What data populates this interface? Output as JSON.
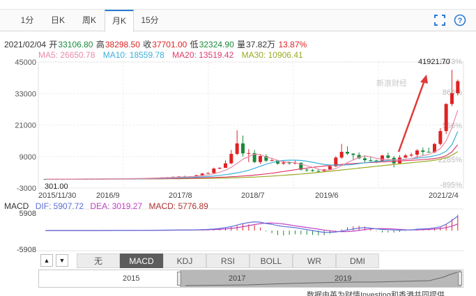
{
  "tabs": [
    {
      "label": "1分"
    },
    {
      "label": "日K"
    },
    {
      "label": "周K"
    },
    {
      "label": "月K"
    },
    {
      "label": "15分"
    }
  ],
  "active_tab": "月K",
  "info": {
    "date": "2021/02/04",
    "open_label": "开",
    "open": "33106.80",
    "high_label": "高",
    "high": "38298.50",
    "close_label": "收",
    "close": "37701.00",
    "low_label": "低",
    "low": "32324.90",
    "vol_label": "量",
    "vol": "37.82万",
    "change": "13.87%"
  },
  "ma": {
    "ma5": "MA5: 26650.78",
    "ma10": "MA10: 18559.78",
    "ma20": "MA20: 13519.42",
    "ma30": "MA30: 10906.41"
  },
  "macd": {
    "title": "MACD",
    "dif": "DIF: 5907.72",
    "dea": "DEA: 3019.27",
    "macd": "MACD: 5776.89"
  },
  "watermark": "新浪财经",
  "indicator_buttons": [
    {
      "label": "无"
    },
    {
      "label": "MACD"
    },
    {
      "label": "KDJ"
    },
    {
      "label": "RSI"
    },
    {
      "label": "BOLL"
    },
    {
      "label": "WR"
    },
    {
      "label": "DMI"
    }
  ],
  "active_indicator": "MACD",
  "nav_years": [
    "2015",
    "2017",
    "2019"
  ],
  "footnote": "数据由英为财情Investing和香港共同提供",
  "colors": {
    "up": "#e02222",
    "down": "#1a8a3a",
    "ma5": "#e88aa8",
    "ma10": "#3ab0d8",
    "ma20": "#e03a6a",
    "ma30": "#9aaa22",
    "dif": "#5b6fd8",
    "dea": "#c040c0",
    "accent": "#2b7bd6"
  },
  "chart_data": {
    "type": "candlestick",
    "yticks": [
      "45000",
      "33000",
      "21000",
      "9000",
      "-3000"
    ],
    "right_ticks": [
      "1173%",
      "864%",
      "556%",
      "2285%",
      "-895%"
    ],
    "xticks": [
      "2015/11/30",
      "2016/9",
      "2017/8",
      "2018/7",
      "2019/6",
      "2021/2/4"
    ],
    "ylim": [
      -3000,
      45000
    ],
    "annotation_max": "41921.70",
    "annotation_min": "301.00",
    "macd_yticks": [
      "5908",
      "-5908"
    ],
    "candles": [
      [
        430,
        420,
        460,
        380
      ],
      [
        420,
        400,
        440,
        370
      ],
      [
        400,
        410,
        430,
        380
      ],
      [
        410,
        380,
        430,
        360
      ],
      [
        380,
        430,
        450,
        370
      ],
      [
        430,
        450,
        470,
        420
      ],
      [
        450,
        440,
        480,
        420
      ],
      [
        440,
        430,
        470,
        410
      ],
      [
        430,
        460,
        490,
        420
      ],
      [
        460,
        470,
        500,
        440
      ],
      [
        470,
        500,
        530,
        460
      ],
      [
        500,
        560,
        580,
        490
      ],
      [
        560,
        600,
        640,
        540
      ],
      [
        600,
        580,
        650,
        560
      ],
      [
        580,
        620,
        660,
        560
      ],
      [
        620,
        670,
        710,
        600
      ],
      [
        670,
        720,
        760,
        650
      ],
      [
        720,
        760,
        800,
        700
      ],
      [
        760,
        830,
        880,
        740
      ],
      [
        830,
        970,
        1000,
        800
      ],
      [
        970,
        1050,
        1100,
        950
      ],
      [
        1050,
        1130,
        1200,
        1000
      ],
      [
        1130,
        1300,
        1350,
        1100
      ],
      [
        1300,
        1420,
        1500,
        1250
      ],
      [
        1420,
        1350,
        1700,
        1300
      ],
      [
        1350,
        1480,
        1550,
        1300
      ],
      [
        1480,
        1900,
        2000,
        1450
      ],
      [
        1900,
        2500,
        2800,
        1850
      ],
      [
        2500,
        2700,
        3000,
        2400
      ],
      [
        2700,
        4400,
        4800,
        2600
      ],
      [
        4400,
        4700,
        4900,
        4200
      ],
      [
        4700,
        6400,
        7500,
        6000
      ],
      [
        6400,
        10000,
        11500,
        6100
      ],
      [
        10000,
        14000,
        19000,
        9500
      ],
      [
        14000,
        10200,
        17000,
        9000
      ],
      [
        10200,
        10300,
        11800,
        6900
      ],
      [
        10300,
        6900,
        11500,
        6500
      ],
      [
        6900,
        9200,
        10000,
        6200
      ],
      [
        9200,
        7400,
        9900,
        6900
      ],
      [
        7400,
        7600,
        8500,
        7200
      ],
      [
        7600,
        6300,
        7700,
        5900
      ],
      [
        6300,
        6700,
        7500,
        5800
      ],
      [
        6700,
        6400,
        7200,
        5900
      ],
      [
        6400,
        6600,
        7400,
        6000
      ],
      [
        6600,
        4000,
        6800,
        3600
      ],
      [
        4000,
        3800,
        4400,
        3200
      ],
      [
        3800,
        3500,
        4300,
        3200
      ],
      [
        3500,
        3400,
        4100,
        3100
      ],
      [
        3400,
        4100,
        4200,
        3300
      ],
      [
        4100,
        5300,
        5800,
        3900
      ],
      [
        5300,
        8600,
        9100,
        5000
      ],
      [
        8600,
        10800,
        13800,
        8100
      ],
      [
        10800,
        10100,
        12900,
        9600
      ],
      [
        10100,
        9600,
        10300,
        7800
      ],
      [
        9600,
        8300,
        10600,
        8000
      ],
      [
        8300,
        7600,
        9500,
        6800
      ],
      [
        7600,
        7500,
        9100,
        6600
      ],
      [
        7500,
        7200,
        7800,
        6500
      ],
      [
        7200,
        9400,
        9600,
        6900
      ],
      [
        9400,
        8500,
        10500,
        8300
      ],
      [
        8500,
        6400,
        9200,
        4800
      ],
      [
        6400,
        8600,
        9500,
        6300
      ],
      [
        8600,
        9400,
        10000,
        8500
      ],
      [
        9400,
        9700,
        10400,
        8800
      ],
      [
        9700,
        11300,
        11800,
        8200
      ],
      [
        11300,
        10800,
        12400,
        9500
      ],
      [
        10800,
        10600,
        12400,
        10500
      ],
      [
        10600,
        13800,
        14100,
        10300
      ],
      [
        13800,
        18700,
        19800,
        13200
      ],
      [
        18700,
        29000,
        29300,
        17600
      ],
      [
        29000,
        33100,
        42000,
        28200
      ],
      [
        33100,
        37700,
        38300,
        32300
      ]
    ],
    "ma5_line": [
      430,
      430,
      425,
      420,
      420,
      430,
      440,
      440,
      445,
      455,
      470,
      500,
      530,
      555,
      575,
      610,
      650,
      690,
      740,
      820,
      900,
      980,
      1060,
      1170,
      1260,
      1330,
      1470,
      1700,
      1990,
      2420,
      3040,
      3800,
      4900,
      6400,
      7950,
      9000,
      9900,
      9800,
      8800,
      8300,
      7500,
      7000,
      6800,
      6600,
      6100,
      5500,
      4900,
      4200,
      3700,
      3900,
      4400,
      5500,
      6700,
      7700,
      8700,
      9200,
      8900,
      8300,
      7900,
      7900,
      7700,
      7700,
      7900,
      8100,
      8900,
      9300,
      9800,
      10700,
      12000,
      15000,
      20000,
      26650
    ],
    "ma10_line": [
      430,
      430,
      430,
      425,
      425,
      428,
      432,
      435,
      436,
      440,
      450,
      470,
      490,
      505,
      520,
      540,
      560,
      590,
      620,
      680,
      740,
      790,
      850,
      920,
      990,
      1060,
      1150,
      1280,
      1410,
      1600,
      1850,
      2100,
      2400,
      2800,
      3200,
      3800,
      4500,
      5300,
      6100,
      6700,
      7200,
      7500,
      7600,
      7600,
      7500,
      7200,
      6800,
      6400,
      6000,
      5800,
      5700,
      5700,
      5800,
      6000,
      6300,
      6600,
      6900,
      7100,
      7300,
      7500,
      7700,
      7800,
      8000,
      8100,
      8400,
      8600,
      8900,
      9300,
      9900,
      11000,
      13500,
      18560
    ],
    "ma20_line": [
      430,
      430,
      430,
      430,
      430,
      430,
      430,
      430,
      430,
      432,
      436,
      442,
      450,
      460,
      470,
      482,
      495,
      510,
      525,
      545,
      570,
      600,
      635,
      675,
      720,
      770,
      820,
      880,
      945,
      1020,
      1100,
      1200,
      1310,
      1440,
      1590,
      1750,
      1930,
      2140,
      2380,
      2660,
      2980,
      3300,
      3630,
      3970,
      4300,
      4600,
      4880,
      5140,
      5380,
      5600,
      5800,
      6000,
      6180,
      6330,
      6470,
      6600,
      6720,
      6840,
      6960,
      7080,
      7190,
      7300,
      7420,
      7540,
      7680,
      7820,
      8000,
      8250,
      8600,
      9300,
      10800,
      13519
    ],
    "ma30_line": [
      430,
      430,
      430,
      430,
      430,
      430,
      430,
      430,
      430,
      430,
      432,
      436,
      440,
      446,
      452,
      459,
      466,
      474,
      483,
      494,
      506,
      520,
      536,
      555,
      576,
      600,
      627,
      658,
      693,
      732,
      776,
      825,
      880,
      945,
      1020,
      1105,
      1200,
      1305,
      1420,
      1550,
      1690,
      1840,
      2000,
      2170,
      2350,
      2540,
      2740,
      2950,
      3170,
      3390,
      3620,
      3860,
      4100,
      4340,
      4580,
      4820,
      5060,
      5290,
      5520,
      5750,
      5980,
      6200,
      6420,
      6640,
      6860,
      7080,
      7320,
      7600,
      7950,
      8500,
      9500,
      10906
    ]
  }
}
